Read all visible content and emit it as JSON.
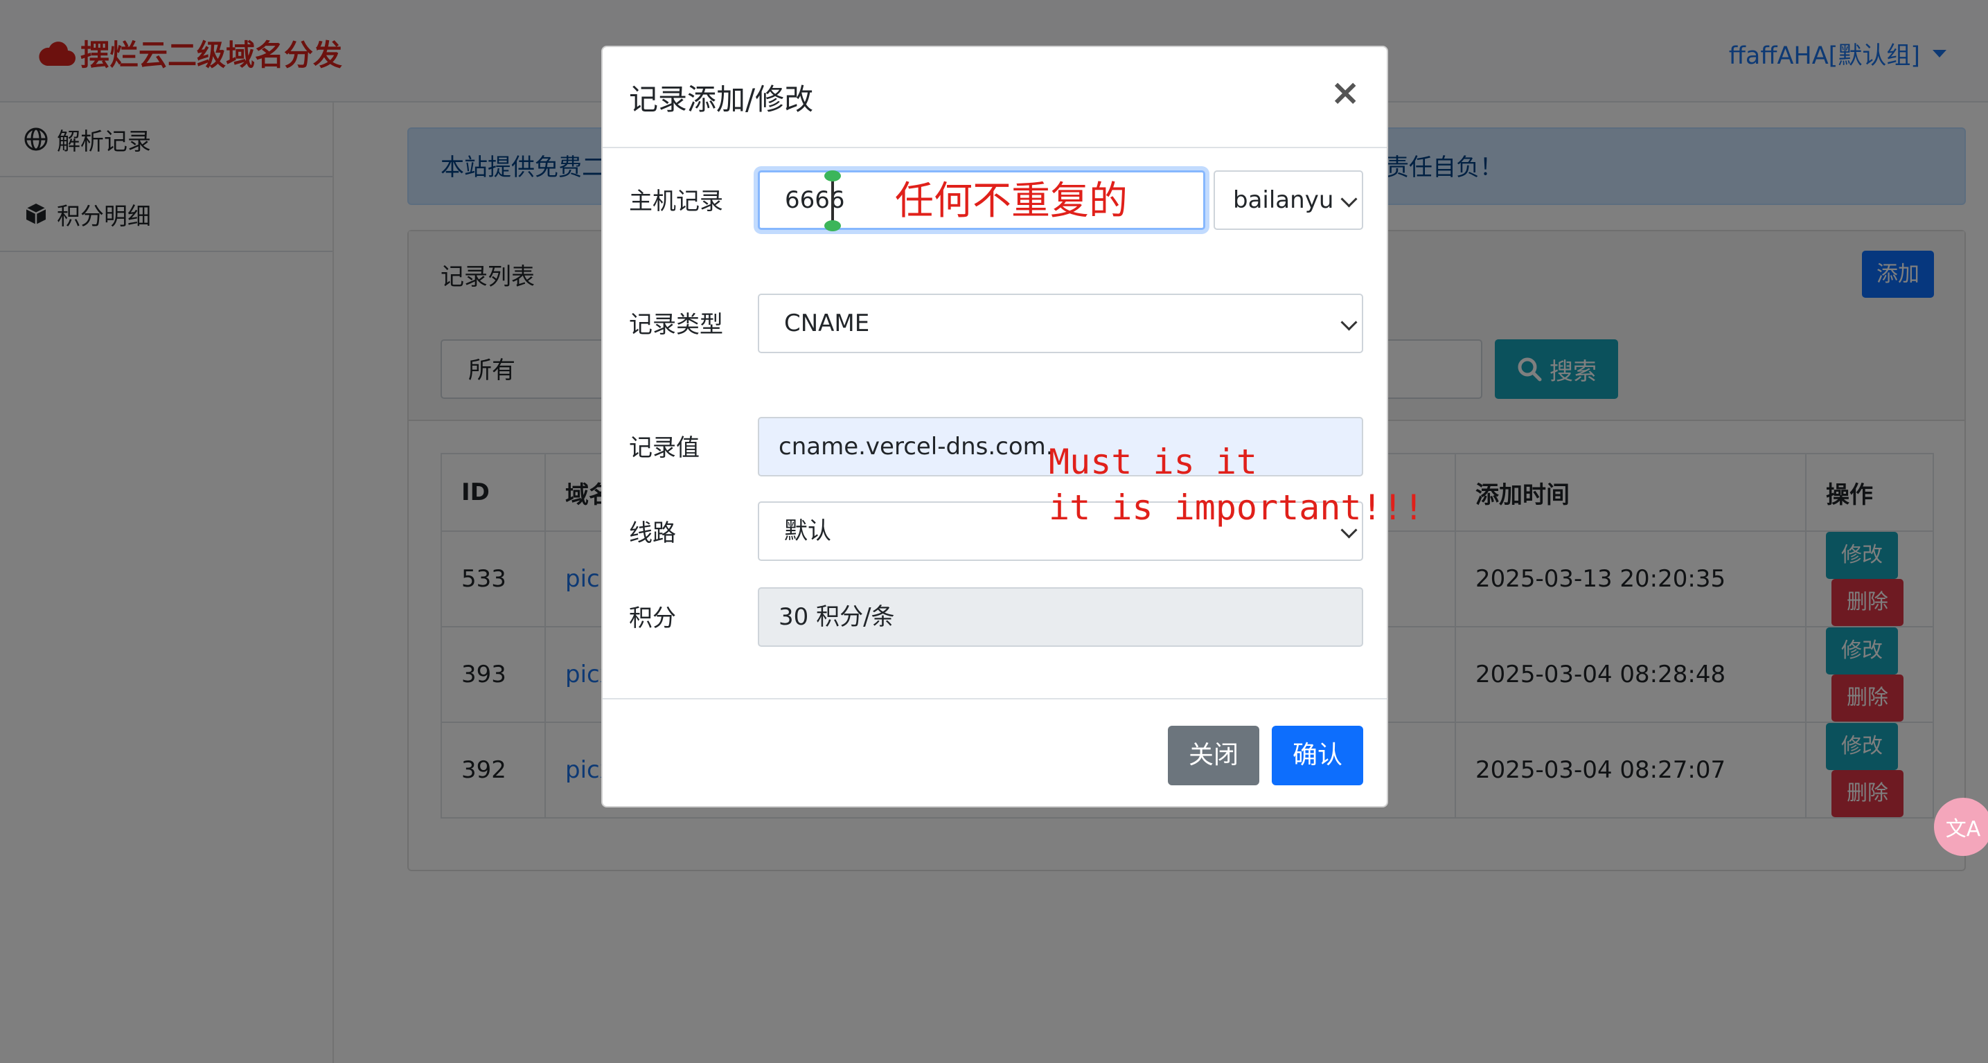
{
  "header": {
    "brand": "摆烂云二级域名分发",
    "user": "ffaffAHA[默认组]"
  },
  "sidebar": {
    "items": [
      {
        "label": "解析记录",
        "icon": "globe-icon"
      },
      {
        "label": "积分明细",
        "icon": "cube-icon"
      }
    ]
  },
  "alert": {
    "left_text": "本站提供免费二",
    "right_text": "责任自负！"
  },
  "records": {
    "title": "记录列表",
    "add_label": "添加",
    "filter_value": "所有",
    "search_label": "搜索",
    "columns": {
      "id": "ID",
      "domain": "域名",
      "time": "添加时间",
      "action": "操作"
    },
    "rows": [
      {
        "id": "533",
        "domain": "pic.b",
        "time": "2025-03-13 20:20:35"
      },
      {
        "id": "393",
        "domain": "picx.",
        "time": "2025-03-04 08:28:48"
      },
      {
        "id": "392",
        "domain": "picx.",
        "time": "2025-03-04 08:27:07"
      }
    ],
    "edit_label": "修改",
    "delete_label": "删除"
  },
  "translate_fab": "文A",
  "modal": {
    "title": "记录添加/修改",
    "close_glyph": "×",
    "host_label": "主机记录",
    "host_value": "6666",
    "domain_suffix": "bailanyu",
    "type_label": "记录类型",
    "type_value": "CNAME",
    "value_label": "记录值",
    "value_value": "cname.vercel-dns.com.",
    "line_label": "线路",
    "line_value": "默认",
    "points_label": "积分",
    "points_value": "30 积分/条",
    "close_button": "关闭",
    "confirm_button": "确认"
  },
  "annotations": {
    "host_note": "任何不重复的",
    "value_note": "Must is it\nit is important!!!"
  },
  "colors": {
    "brand": "#d9231c",
    "primary": "#0d6efd",
    "info": "#17a2b8",
    "danger": "#dc3545",
    "annotation": "#e0201a"
  }
}
